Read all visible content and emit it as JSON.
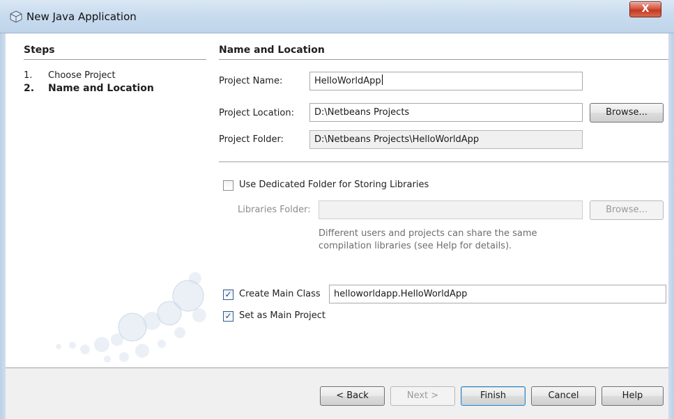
{
  "window": {
    "title": "New Java Application",
    "close_glyph": "X"
  },
  "steps": {
    "heading": "Steps",
    "items": [
      {
        "number": "1.",
        "label": "Choose Project"
      },
      {
        "number": "2.",
        "label": "Name and Location"
      }
    ]
  },
  "form": {
    "heading": "Name and Location",
    "project_name": {
      "label": "Project Name:",
      "value": "HelloWorldApp"
    },
    "project_location": {
      "label": "Project Location:",
      "value": "D:\\Netbeans Projects",
      "browse_label": "Browse..."
    },
    "project_folder": {
      "label": "Project Folder:",
      "value": "D:\\Netbeans Projects\\HelloWorldApp"
    },
    "dedicated_folder": {
      "label": "Use Dedicated Folder for Storing Libraries",
      "checked": false
    },
    "libraries_folder": {
      "label": "Libraries Folder:",
      "value": "",
      "browse_label": "Browse..."
    },
    "libraries_note_line1": "Different users and projects can share the same",
    "libraries_note_line2": "compilation libraries (see Help for details).",
    "create_main_class": {
      "label": "Create Main Class",
      "checked": true,
      "value": "helloworldapp.HelloWorldApp"
    },
    "set_main_project": {
      "label": "Set as Main Project",
      "checked": true
    }
  },
  "buttons": {
    "back": "< Back",
    "next": "Next >",
    "finish": "Finish",
    "cancel": "Cancel",
    "help": "Help"
  },
  "check_glyph": "✓"
}
